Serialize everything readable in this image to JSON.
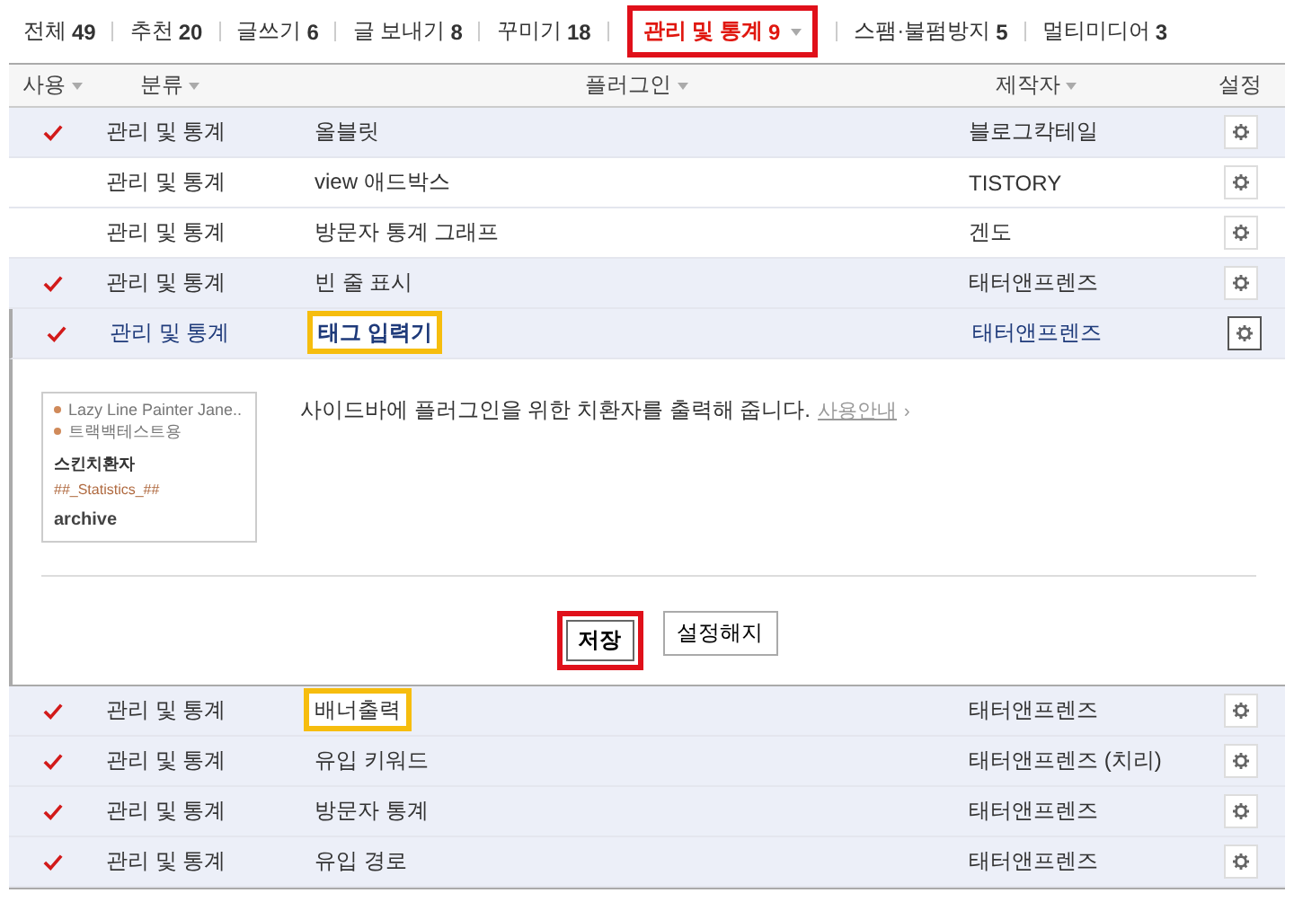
{
  "tabs": [
    {
      "label": "전체",
      "count": "49",
      "selected": false,
      "dropdown": false
    },
    {
      "label": "추천",
      "count": "20",
      "selected": false,
      "dropdown": false
    },
    {
      "label": "글쓰기",
      "count": "6",
      "selected": false,
      "dropdown": false
    },
    {
      "label": "글 보내기",
      "count": "8",
      "selected": false,
      "dropdown": false
    },
    {
      "label": "꾸미기",
      "count": "18",
      "selected": false,
      "dropdown": false
    },
    {
      "label": "관리 및 통계",
      "count": "9",
      "selected": true,
      "dropdown": true
    },
    {
      "label": "스팸·불펌방지",
      "count": "5",
      "selected": false,
      "dropdown": false
    },
    {
      "label": "멀티미디어",
      "count": "3",
      "selected": false,
      "dropdown": false
    }
  ],
  "table": {
    "columns": [
      {
        "label": "사용",
        "sortable": true
      },
      {
        "label": "분류",
        "sortable": true
      },
      {
        "label": "플러그인",
        "sortable": true
      },
      {
        "label": "제작자",
        "sortable": true
      },
      {
        "label": "설정",
        "sortable": false
      }
    ],
    "rows": [
      {
        "used": true,
        "category": "관리 및 통계",
        "name": "올블릿",
        "author": "블로그칵테일",
        "highlighted": false,
        "expanded": false
      },
      {
        "used": false,
        "category": "관리 및 통계",
        "name": "view 애드박스",
        "author": "TISTORY",
        "highlighted": false,
        "expanded": false
      },
      {
        "used": false,
        "category": "관리 및 통계",
        "name": "방문자 통계 그래프",
        "author": "겐도",
        "highlighted": false,
        "expanded": false
      },
      {
        "used": true,
        "category": "관리 및 통계",
        "name": "빈 줄 표시",
        "author": "태터앤프렌즈",
        "highlighted": false,
        "expanded": false
      },
      {
        "used": true,
        "category": "관리 및 통계",
        "name": "태그 입력기",
        "author": "태터앤프렌즈",
        "highlighted": true,
        "expanded": true
      },
      {
        "used": true,
        "category": "관리 및 통계",
        "name": "배너출력",
        "author": "태터앤프렌즈",
        "highlighted": true,
        "expanded": false
      },
      {
        "used": true,
        "category": "관리 및 통계",
        "name": "유입 키워드",
        "author": "태터앤프렌즈 (치리)",
        "highlighted": false,
        "expanded": false
      },
      {
        "used": true,
        "category": "관리 및 통계",
        "name": "방문자 통계",
        "author": "태터앤프렌즈",
        "highlighted": false,
        "expanded": false
      },
      {
        "used": true,
        "category": "관리 및 통계",
        "name": "유입 경로",
        "author": "태터앤프렌즈",
        "highlighted": false,
        "expanded": false
      }
    ]
  },
  "detail": {
    "preview": {
      "items": [
        {
          "kind": "bullet",
          "text": "Lazy Line Painter Jane.."
        },
        {
          "kind": "bullet",
          "text": "트랙백테스트용"
        },
        {
          "kind": "heading",
          "text": "스킨치환자"
        },
        {
          "kind": "code",
          "text": "##_Statistics_##"
        },
        {
          "kind": "title",
          "text": "archive"
        }
      ]
    },
    "description": "사이드바에 플러그인을 위한 치환자를 출력해 줍니다.",
    "link": "사용안내",
    "link_arrow": "›",
    "buttons": [
      {
        "label": "저장",
        "highlighted": true,
        "primary": true
      },
      {
        "label": "설정해지",
        "highlighted": false,
        "primary": false
      }
    ]
  }
}
